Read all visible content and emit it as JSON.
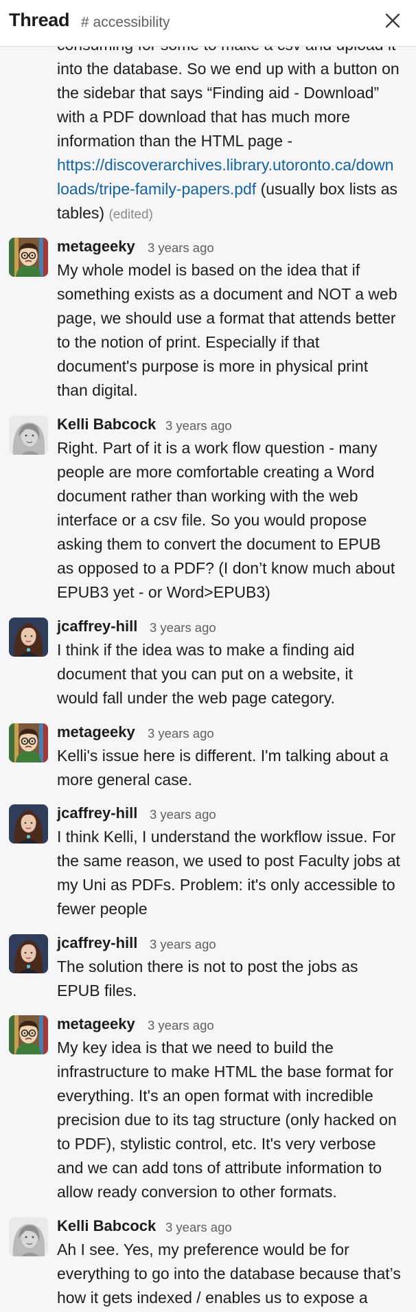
{
  "header": {
    "title": "Thread",
    "channel": "# accessibility",
    "close_icon": "close-icon"
  },
  "first_message": {
    "lines": [
      "consuming for some to make a csv and upload it",
      "into the database. So we end up with a button on",
      "the sidebar that says “Finding aid - Download”",
      "with a PDF download that has much more",
      "information than the HTML page -"
    ],
    "link_line1": "https://discoverarchives.library.utoronto.ca/down",
    "link_line2": "loads/tripe-family-papers.pdf",
    "after_link": " (usually box lists as",
    "last_line": "tables)",
    "edited": "(edited)"
  },
  "messages": [
    {
      "author": "metageeky",
      "time": "3 years ago",
      "avatar": "metageeky-avatar",
      "lines": [
        "My whole model is based on the idea that if",
        "something exists as a document and NOT a web",
        "page, we should use a format that attends better",
        "to the notion of print. Especially if that",
        "document's purpose is more in physical print",
        "than digital."
      ]
    },
    {
      "author": "Kelli Babcock",
      "time": "3 years ago",
      "avatar": "kelli-avatar",
      "lines": [
        "Right. Part of it is a work flow question - many",
        "people are more comfortable creating a Word",
        "document rather than working with the web",
        "interface or a csv file. So you would propose",
        "asking them to convert the document to EPUB",
        "as opposed to a PDF? (I don’t know much about",
        "EPUB3 yet - or Word>EPUB3)"
      ]
    },
    {
      "author": "jcaffrey-hill",
      "time": "3 years ago",
      "avatar": "jcaffrey-avatar",
      "lines": [
        "I think if the idea was to make a finding aid",
        "document that you can put on a website, it",
        "would fall under the web page category."
      ]
    },
    {
      "author": "metageeky",
      "time": "3 years ago",
      "avatar": "metageeky-avatar",
      "lines": [
        "Kelli's issue here is different. I'm talking about a",
        "more general case."
      ]
    },
    {
      "author": "jcaffrey-hill",
      "time": "3 years ago",
      "avatar": "jcaffrey-avatar",
      "lines": [
        "I think Kelli, I understand the workflow issue. For",
        "the same reason, we used to post Faculty jobs at",
        "my Uni as PDFs. Problem: it's only accessible to",
        "fewer people"
      ]
    },
    {
      "author": "jcaffrey-hill",
      "time": "3 years ago",
      "avatar": "jcaffrey-avatar",
      "lines": [
        "The solution there is not to post the jobs as",
        "EPUB files."
      ]
    },
    {
      "author": "metageeky",
      "time": "3 years ago",
      "avatar": "metageeky-avatar",
      "lines": [
        "My key idea is that we need to build the",
        "infrastructure to make HTML the base format for",
        "everything. It's an open format with incredible",
        "precision due to its tag structure (only hacked on",
        "to PDF), stylistic control, etc. It's very verbose",
        "and we can add tons of attribute information to",
        "allow ready conversion to other formats."
      ]
    },
    {
      "author": "Kelli Babcock",
      "time": "3 years ago",
      "avatar": "kelli-avatar",
      "lines": [
        "Ah I see. Yes, my preference would be for",
        "everything to go into the database because that’s",
        "how it gets indexed / enables us to expose a"
      ]
    }
  ]
}
